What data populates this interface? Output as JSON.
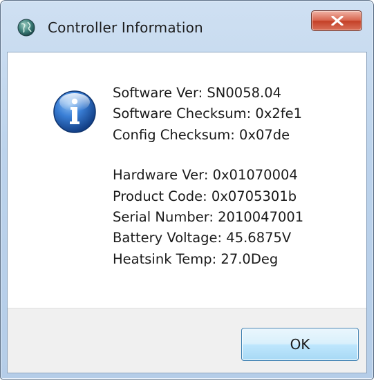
{
  "window": {
    "title": "Controller Information"
  },
  "message": {
    "lines_group1": [
      "Software Ver: SN0058.04",
      "Software Checksum: 0x2fe1",
      "Config Checksum: 0x07de"
    ],
    "lines_group2": [
      "Hardware Ver: 0x01070004",
      "Product Code: 0x0705301b",
      "Serial Number: 2010047001",
      "Battery Voltage: 45.6875V",
      "Heatsink Temp: 27.0Deg"
    ]
  },
  "buttons": {
    "ok_label": "OK"
  },
  "icons": {
    "app": "globe-icon",
    "close": "close-icon",
    "info": "info-icon"
  },
  "colors": {
    "titlebar": "#bcd3ec",
    "close_button": "#c44027",
    "info_icon": "#1f5fb8",
    "footer": "#f0f0f0"
  }
}
